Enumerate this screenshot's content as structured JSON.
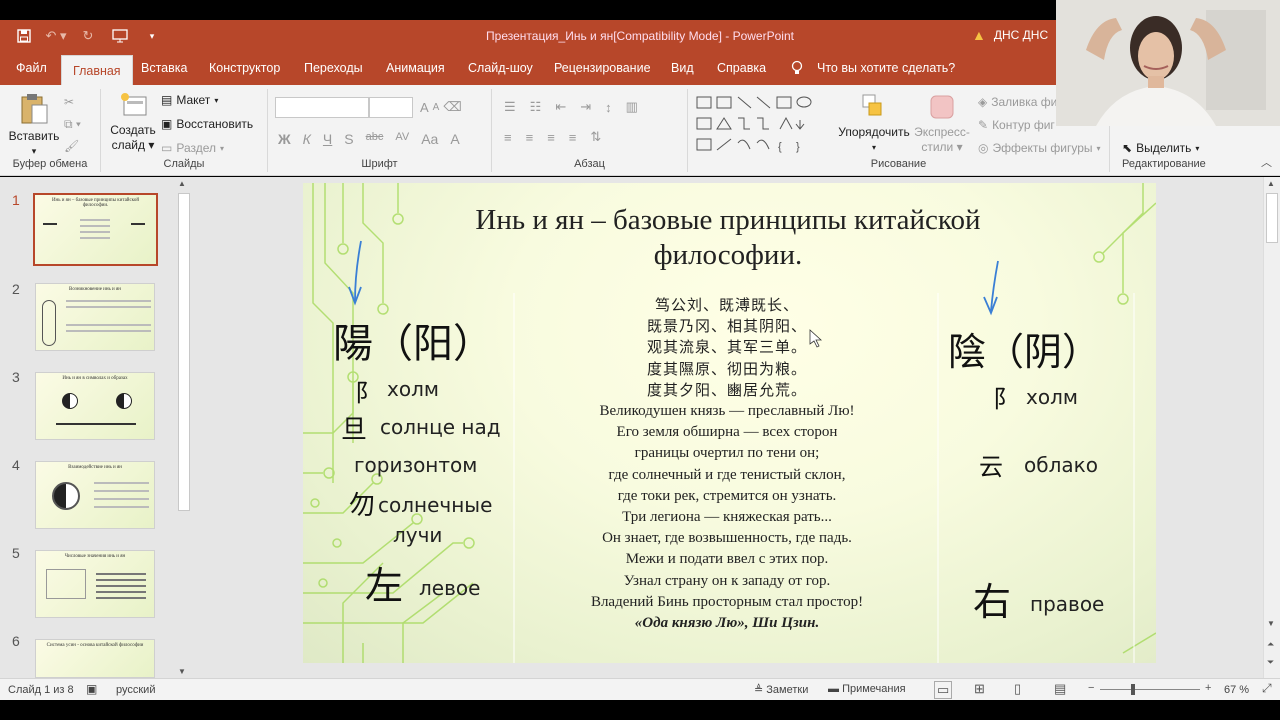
{
  "window": {
    "title": "Презентация_Инь и ян[Compatibility Mode]  -  PowerPoint",
    "user": "ДНС ДНС"
  },
  "qat": {
    "icons": [
      "save-icon",
      "undo-icon",
      "redo-icon",
      "present-icon",
      "customize-icon"
    ]
  },
  "tabs": [
    "Файл",
    "Главная",
    "Вставка",
    "Конструктор",
    "Переходы",
    "Анимация",
    "Слайд-шоу",
    "Рецензирование",
    "Вид",
    "Справка"
  ],
  "tell_me": "Что вы хотите сделать?",
  "ribbon": {
    "clipboard": {
      "paste": "Вставить",
      "group": "Буфер обмена"
    },
    "slides": {
      "new_slide_l1": "Создать",
      "new_slide_l2": "слайд",
      "layout": "Макет",
      "reset": "Восстановить",
      "section": "Раздел",
      "group": "Слайды"
    },
    "font": {
      "bold": "Ж",
      "italic": "К",
      "underline": "Ч",
      "shadow": "S",
      "strike": "abc",
      "spacing": "AV",
      "case": "Aa",
      "color": "A",
      "grow": "A",
      "shrink": "A",
      "group": "Шрифт"
    },
    "paragraph": {
      "group": "Абзац"
    },
    "drawing": {
      "arrange": "Упорядочить",
      "styles_l1": "Экспресс-",
      "styles_l2": "стили",
      "fill": "Заливка фи",
      "outline": "Контур фиг",
      "effects": "Эффекты фигуры",
      "group": "Рисование"
    },
    "editing": {
      "select": "Выделить",
      "group": "Редактирование"
    }
  },
  "thumbnails": {
    "numbers": [
      "1",
      "2",
      "3",
      "4",
      "5",
      "6"
    ],
    "titles": [
      "Инь и ян – базовые принципы китайской философии.",
      "Возникновение инь и ян",
      "Инь и ян в символах и образах",
      "Взаимодействие инь и ян",
      "Числовые значения инь и ян",
      "Система усин - основа китайской философии"
    ]
  },
  "slide": {
    "title_l1": "Инь и ян – базовые принципы китайской",
    "title_l2": "философии.",
    "yang_char": "陽（阳）",
    "yin_char": "陰（阴）",
    "left": {
      "c1": "阝",
      "t1": "холм",
      "c2": "旦",
      "t2a": "солнце над",
      "t2b": "горизонтом",
      "c3": "勿",
      "t3a": "солнечные",
      "t3b": "лучи",
      "c4": "左",
      "t4": "левое"
    },
    "right": {
      "c1": "阝",
      "t1": "холм",
      "c2": "云",
      "t2": "облако",
      "c3": "右",
      "t3": "правое"
    },
    "poem_cn": [
      "笃公刘、既溥既长、",
      "既景乃冈、相其阴阳、",
      "观其流泉、其军三单。",
      "度其隰原、彻田为粮。",
      "度其夕阳、豳居允荒。"
    ],
    "poem_ru": [
      "Великодушен князь — преславный Лю!",
      "Его земля обширна — всех сторон",
      "границы очертил по тени он;",
      "где солнечный и где тенистый склон,",
      "где токи рек, стремится он узнать.",
      "Три легиона — княжеская рать...",
      "Он знает, где возвышенность, где падь.",
      "Межи и подати ввел с этих пор.",
      "Узнал страну он к западу от гор.",
      "Владений Бинь просторным стал простор!"
    ],
    "cite": "«Ода князю Лю», Ши Цзин."
  },
  "status": {
    "slide_info": "Слайд 1 из 8",
    "language": "русский",
    "notes": "Заметки",
    "comments": "Примечания",
    "zoom": "67 %"
  },
  "colors": {
    "accent": "#b7472a",
    "arrow": "#3a7fd5",
    "circuit": "#8ccf3b"
  }
}
